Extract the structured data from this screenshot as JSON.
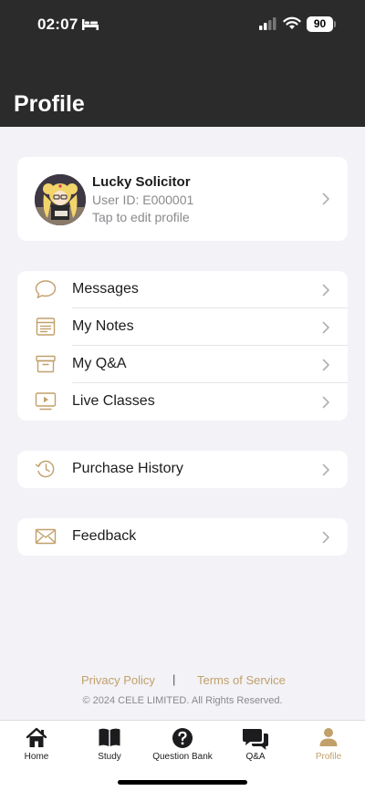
{
  "status_bar": {
    "time": "02:07",
    "battery": "90"
  },
  "header": {
    "title": "Profile"
  },
  "profile": {
    "name": "Lucky Solicitor",
    "user_id": "User ID: E000001",
    "edit_hint": "Tap to edit profile"
  },
  "menu": {
    "items": [
      {
        "label": "Messages",
        "icon": "chat-bubble-icon"
      },
      {
        "label": "My Notes",
        "icon": "notes-icon"
      },
      {
        "label": "My Q&A",
        "icon": "archive-box-icon"
      },
      {
        "label": "Live Classes",
        "icon": "play-screen-icon"
      }
    ]
  },
  "history": {
    "label": "Purchase History",
    "icon": "history-clock-icon"
  },
  "feedback": {
    "label": "Feedback",
    "icon": "envelope-icon"
  },
  "footer": {
    "privacy": "Privacy Policy",
    "separator": "|",
    "terms": "Terms of Service",
    "copyright": "© 2024 CELE LIMITED. All Rights Reserved."
  },
  "tabs": [
    {
      "label": "Home",
      "icon": "home-icon",
      "active": false
    },
    {
      "label": "Study",
      "icon": "book-icon",
      "active": false
    },
    {
      "label": "Question Bank",
      "icon": "question-circle-icon",
      "active": false
    },
    {
      "label": "Q&A",
      "icon": "chat-bubbles-icon",
      "active": false
    },
    {
      "label": "Profile",
      "icon": "person-icon",
      "active": true
    }
  ],
  "colors": {
    "accent": "#c2a06a",
    "header_bg": "#2b2b2b",
    "page_bg": "#f2f2f7"
  }
}
